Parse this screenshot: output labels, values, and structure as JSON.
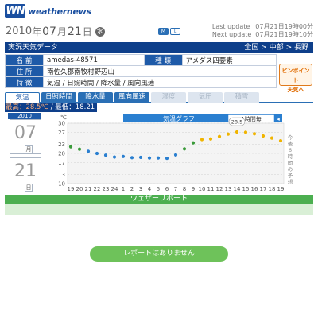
{
  "brand": {
    "logo_mark": "WN",
    "logo_text": "weathernews"
  },
  "date": {
    "year": "2010",
    "year_unit": "年",
    "month": "07",
    "month_unit": "月",
    "day": "21",
    "day_unit": "日",
    "weekday": "水"
  },
  "size_buttons": [
    "M",
    "L"
  ],
  "update": {
    "last_label": "Last update",
    "last_value": "07月21日19時00分",
    "next_label": "Next update",
    "next_value": "07月21日19時10分"
  },
  "section": {
    "title": "実況天気データ",
    "breadcrumb": [
      "全国",
      "中部",
      "長野"
    ],
    "sep": " > "
  },
  "info": {
    "name_label": "名 前",
    "name_value": "amedas-48571",
    "kind_label": "種 類",
    "kind_value": "アメダス四要素",
    "addr_label": "住 所",
    "addr_value": "南佐久郡南牧村野辺山",
    "feat_label": "特 徴",
    "feat_value": "気温 / 日照時間 / 降水量 / 風向風速"
  },
  "pinpoint": {
    "line1": "ピンポイント",
    "line2": "天気へ"
  },
  "tabs": [
    {
      "label": "気温",
      "state": "active"
    },
    {
      "label": "日照時間",
      "state": "normal"
    },
    {
      "label": "降水量",
      "state": "normal"
    },
    {
      "label": "風向風速",
      "state": "normal"
    },
    {
      "label": "湿度",
      "state": "dim"
    },
    {
      "label": "気圧",
      "state": "dim"
    },
    {
      "label": "積雪",
      "state": "dim"
    }
  ],
  "hilo": {
    "hi_label": "最高：",
    "hi_value": "28.5℃",
    "sep": " / ",
    "lo_label": "最低：",
    "lo_value": "18.21"
  },
  "cards": {
    "year": "2010",
    "month": "07",
    "day": "21",
    "month_unit": "月",
    "day_unit": "日"
  },
  "chart_data": {
    "type": "scatter",
    "title": "気温グラフ",
    "period_select": "1時間毎",
    "ylabel": "℃",
    "ylim": [
      10,
      30
    ],
    "yticks": [
      30,
      27,
      23,
      20,
      17,
      13,
      10
    ],
    "x": [
      "19",
      "20",
      "21",
      "22",
      "23",
      "24",
      "1",
      "2",
      "3",
      "4",
      "5",
      "6",
      "7",
      "8",
      "9",
      "10",
      "11",
      "12",
      "13",
      "14",
      "15",
      "16",
      "17",
      "18",
      "19"
    ],
    "observed": [
      22.2,
      21.4,
      20.7,
      20.0,
      19.4,
      18.8,
      19.0,
      18.6,
      18.7,
      18.5,
      18.5,
      18.4,
      19.5,
      21.5,
      23.5
    ],
    "forecast": [
      24.6,
      24.8,
      25.6,
      26.4,
      27.1,
      27.0,
      26.5,
      25.8,
      25.1,
      24.2
    ],
    "callout": "28.5",
    "forecast_note": "今後6時間の予想",
    "colors": {
      "observed_early": "#3a9a3a",
      "observed": "#2a7fd0",
      "forecast": "#f0b400"
    }
  },
  "report": {
    "header": "ウェザーリポート",
    "empty": "レポートはありません"
  }
}
